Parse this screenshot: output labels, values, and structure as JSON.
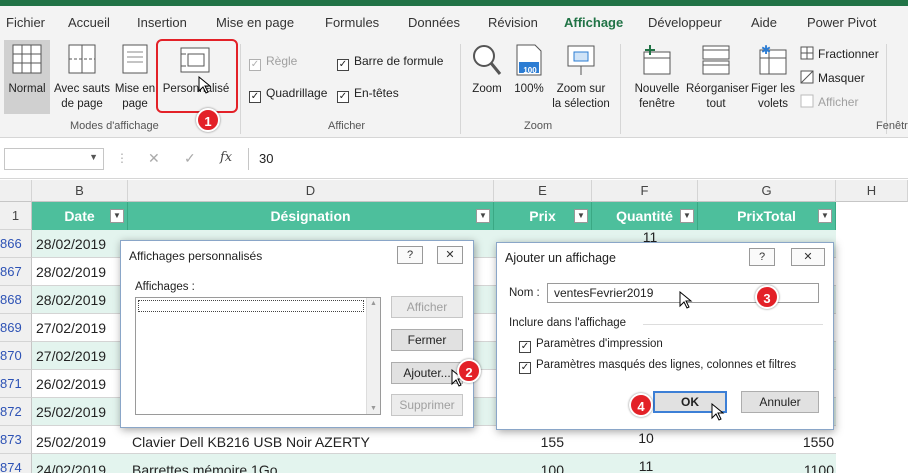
{
  "ribbon_tabs": [
    "Fichier",
    "Accueil",
    "Insertion",
    "Mise en page",
    "Formules",
    "Données",
    "Révision",
    "Affichage",
    "Développeur",
    "Aide",
    "Power Pivot"
  ],
  "active_tab": "Affichage",
  "groups": {
    "modes": {
      "label": "Modes d'affichage",
      "normal": "Normal",
      "sauts_1": "Avec sauts",
      "sauts_2": "de page",
      "mise_1": "Mise en",
      "mise_2": "page",
      "perso": "Personnalisé"
    },
    "afficher": {
      "label": "Afficher",
      "regle": "Règle",
      "barre_formule": "Barre de formule",
      "quadrillage": "Quadrillage",
      "entetes": "En-têtes"
    },
    "zoom": {
      "label": "Zoom",
      "zoom": "Zoom",
      "pct": "100%",
      "zoom_sel_1": "Zoom sur",
      "zoom_sel_2": "la sélection",
      "pct_icon_text": "100"
    },
    "fenetre": {
      "label": "Fenêtre",
      "nouvelle_1": "Nouvelle",
      "nouvelle_2": "fenêtre",
      "reorg_1": "Réorganiser",
      "reorg_2": "tout",
      "figer_1": "Figer les",
      "figer_2": "volets",
      "fractionner": "Fractionner",
      "masquer": "Masquer",
      "afficher": "Afficher"
    }
  },
  "formula_bar": {
    "name_box": "",
    "cancel": "✕",
    "enter": "✓",
    "fx": "fx",
    "value": "30"
  },
  "columns": [
    "B",
    "D",
    "E",
    "F",
    "G",
    "H"
  ],
  "headers": [
    "Date",
    "Désignation",
    "Prix",
    "Quantité",
    "PrixTotal"
  ],
  "header_row_num": "1",
  "rows": [
    {
      "num": "866",
      "date": "28/02/2019",
      "desc": "",
      "prix": "",
      "qte": "11",
      "total": ""
    },
    {
      "num": "867",
      "date": "28/02/2019",
      "desc": "",
      "prix": "",
      "qte": "",
      "total": ""
    },
    {
      "num": "868",
      "date": "28/02/2019",
      "desc": "",
      "prix": "",
      "qte": "",
      "total": ""
    },
    {
      "num": "869",
      "date": "27/02/2019",
      "desc": "",
      "prix": "",
      "qte": "",
      "total": ""
    },
    {
      "num": "870",
      "date": "27/02/2019",
      "desc": "",
      "prix": "",
      "qte": "",
      "total": ""
    },
    {
      "num": "871",
      "date": "26/02/2019",
      "desc": "",
      "prix": "",
      "qte": "",
      "total": ""
    },
    {
      "num": "872",
      "date": "25/02/2019",
      "desc": "",
      "prix": "",
      "qte": "",
      "total": ""
    },
    {
      "num": "873",
      "date": "25/02/2019",
      "desc": "Clavier Dell KB216 USB Noir AZERTY",
      "prix": "155",
      "qte": "10",
      "total": "1550"
    },
    {
      "num": "874",
      "date": "24/02/2019",
      "desc": "Barrettes mémoire 1Go",
      "prix": "100",
      "qte": "11",
      "total": "1100"
    }
  ],
  "dialog_views": {
    "title": "Affichages personnalisés",
    "help": "?",
    "close": "✕",
    "list_label": "Affichages :",
    "btn_afficher": "Afficher",
    "btn_fermer": "Fermer",
    "btn_ajouter": "Ajouter...",
    "btn_supprimer": "Supprimer"
  },
  "dialog_add": {
    "title": "Ajouter un affichage",
    "help": "?",
    "close": "✕",
    "nom_label": "Nom :",
    "nom_value": "ventesFevrier2019",
    "section_label": "Inclure dans l'affichage",
    "opt_impression": "Paramètres d'impression",
    "opt_masques": "Paramètres masqués des lignes, colonnes et filtres",
    "btn_ok": "OK",
    "btn_annuler": "Annuler"
  },
  "callouts": [
    "1",
    "2",
    "3",
    "4"
  ],
  "colors": {
    "excel_green": "#217346",
    "header_teal": "#4dbf9c",
    "row_teal_light": "#e3f4ee",
    "callout_red": "#e32128"
  }
}
